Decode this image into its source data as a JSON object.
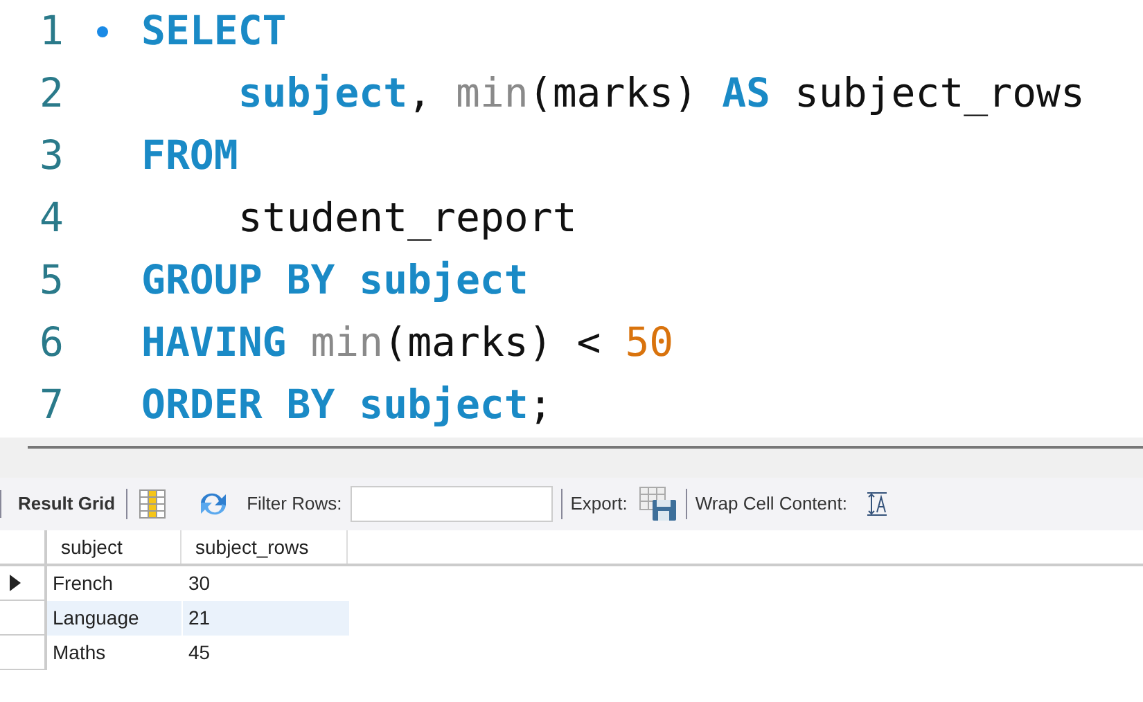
{
  "editor": {
    "lines": [
      {
        "number": "1",
        "marker": true,
        "indent": false,
        "tokens": [
          {
            "kind": "keyword",
            "text": "SELECT"
          }
        ]
      },
      {
        "number": "2",
        "marker": false,
        "indent": true,
        "tokens": [
          {
            "kind": "keyword",
            "text": "subject"
          },
          {
            "kind": "plain",
            "text": ", "
          },
          {
            "kind": "function",
            "text": "min"
          },
          {
            "kind": "plain",
            "text": "(marks) "
          },
          {
            "kind": "keyword",
            "text": "AS"
          },
          {
            "kind": "plain",
            "text": " subject_rows"
          }
        ]
      },
      {
        "number": "3",
        "marker": false,
        "indent": false,
        "tokens": [
          {
            "kind": "keyword",
            "text": "FROM"
          }
        ]
      },
      {
        "number": "4",
        "marker": false,
        "indent": true,
        "tokens": [
          {
            "kind": "plain",
            "text": "student_report"
          }
        ]
      },
      {
        "number": "5",
        "marker": false,
        "indent": false,
        "tokens": [
          {
            "kind": "keyword",
            "text": "GROUP BY subject"
          }
        ]
      },
      {
        "number": "6",
        "marker": false,
        "indent": false,
        "tokens": [
          {
            "kind": "keyword",
            "text": "HAVING"
          },
          {
            "kind": "function",
            "text": " min"
          },
          {
            "kind": "plain",
            "text": "(marks) < "
          },
          {
            "kind": "number",
            "text": "50"
          }
        ]
      },
      {
        "number": "7",
        "marker": false,
        "indent": false,
        "tokens": [
          {
            "kind": "keyword",
            "text": "ORDER BY subject"
          },
          {
            "kind": "plain",
            "text": ";"
          }
        ]
      }
    ]
  },
  "toolbar": {
    "result_grid": "Result Grid",
    "filter_label": "Filter Rows:",
    "export_label": "Export:",
    "wrap_label": "Wrap Cell Content:"
  },
  "grid": {
    "columns": [
      "subject",
      "subject_rows"
    ],
    "rows": [
      {
        "cells": [
          "French",
          "30"
        ],
        "current": true,
        "selected": false
      },
      {
        "cells": [
          "Language",
          "21"
        ],
        "current": false,
        "selected": true
      },
      {
        "cells": [
          "Maths",
          "45"
        ],
        "current": false,
        "selected": false
      }
    ]
  }
}
